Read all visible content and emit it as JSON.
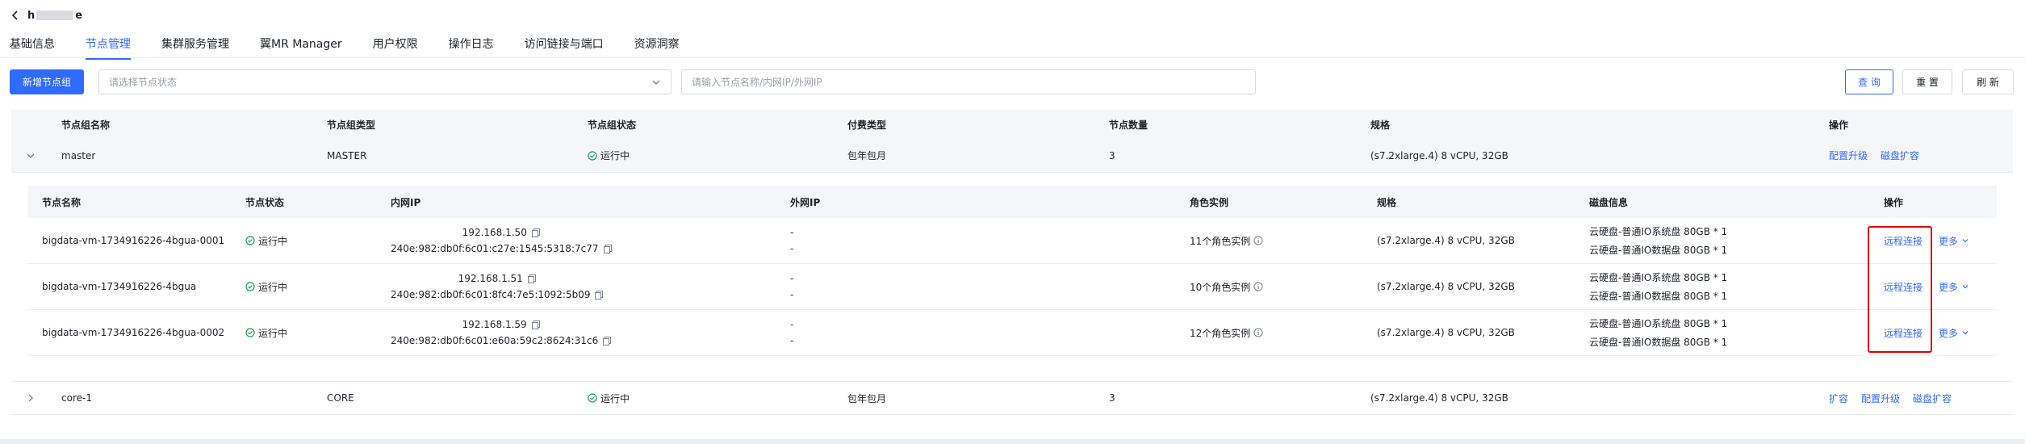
{
  "header": {
    "back_icon": "chevron-left-icon",
    "title_prefix": "h",
    "title_suffix": "e"
  },
  "tabs": [
    {
      "label": "基础信息",
      "active": false
    },
    {
      "label": "节点管理",
      "active": true
    },
    {
      "label": "集群服务管理",
      "active": false
    },
    {
      "label": "翼MR Manager",
      "active": false
    },
    {
      "label": "用户权限",
      "active": false
    },
    {
      "label": "操作日志",
      "active": false
    },
    {
      "label": "访问链接与端口",
      "active": false
    },
    {
      "label": "资源洞察",
      "active": false
    }
  ],
  "toolbar": {
    "add_button": "新增节点组",
    "status_select_placeholder": "请选择节点状态",
    "search_placeholder": "请输入节点名称/内网IP/外网IP",
    "query_button": "查 询",
    "reset_button": "重 置",
    "refresh_button": "刷 新"
  },
  "group_table": {
    "headers": [
      "节点组名称",
      "节点组类型",
      "节点组状态",
      "付费类型",
      "节点数量",
      "规格",
      "操作"
    ],
    "rows": [
      {
        "name": "master",
        "type": "MASTER",
        "status": "运行中",
        "pay": "包年包月",
        "count": "3",
        "spec": "(s7.2xlarge.4) 8 vCPU, 32GB",
        "actions": [
          "配置升级",
          "磁盘扩容"
        ]
      },
      {
        "name": "core-1",
        "type": "CORE",
        "status": "运行中",
        "pay": "包年包月",
        "count": "3",
        "spec": "(s7.2xlarge.4) 8 vCPU, 32GB",
        "actions": [
          "扩容",
          "配置升级",
          "磁盘扩容"
        ]
      }
    ]
  },
  "node_table": {
    "headers": [
      "节点名称",
      "节点状态",
      "内网IP",
      "外网IP",
      "角色实例",
      "规格",
      "磁盘信息",
      "操作"
    ],
    "rows": [
      {
        "name": "bigdata-vm-1734916226-4bgua-0001",
        "status": "运行中",
        "ipv4": "192.168.1.50",
        "ipv6": "240e:982:db0f:6c01:c27e:1545:5318:7c77",
        "ext1": "-",
        "ext2": "-",
        "roles": "11个角色实例",
        "spec": "(s7.2xlarge.4) 8 vCPU, 32GB",
        "disk1": "云硬盘-普通IO系统盘 80GB * 1",
        "disk2": "云硬盘-普通IO数据盘 80GB * 1",
        "remote": "远程连接",
        "more": "更多"
      },
      {
        "name": "bigdata-vm-1734916226-4bgua",
        "status": "运行中",
        "ipv4": "192.168.1.51",
        "ipv6": "240e:982:db0f:6c01:8fc4:7e5:1092:5b09",
        "ext1": "-",
        "ext2": "-",
        "roles": "10个角色实例",
        "spec": "(s7.2xlarge.4) 8 vCPU, 32GB",
        "disk1": "云硬盘-普通IO系统盘 80GB * 1",
        "disk2": "云硬盘-普通IO数据盘 80GB * 1",
        "remote": "远程连接",
        "more": "更多"
      },
      {
        "name": "bigdata-vm-1734916226-4bgua-0002",
        "status": "运行中",
        "ipv4": "192.168.1.59",
        "ipv6": "240e:982:db0f:6c01:e60a:59c2:8624:31c6",
        "ext1": "-",
        "ext2": "-",
        "roles": "12个角色实例",
        "spec": "(s7.2xlarge.4) 8 vCPU, 32GB",
        "disk1": "云硬盘-普通IO系统盘 80GB * 1",
        "disk2": "云硬盘-普通IO数据盘 80GB * 1",
        "remote": "远程连接",
        "more": "更多"
      }
    ]
  },
  "colors": {
    "accent": "#2f6bff",
    "success": "#19a35a",
    "highlight": "#e60000"
  }
}
